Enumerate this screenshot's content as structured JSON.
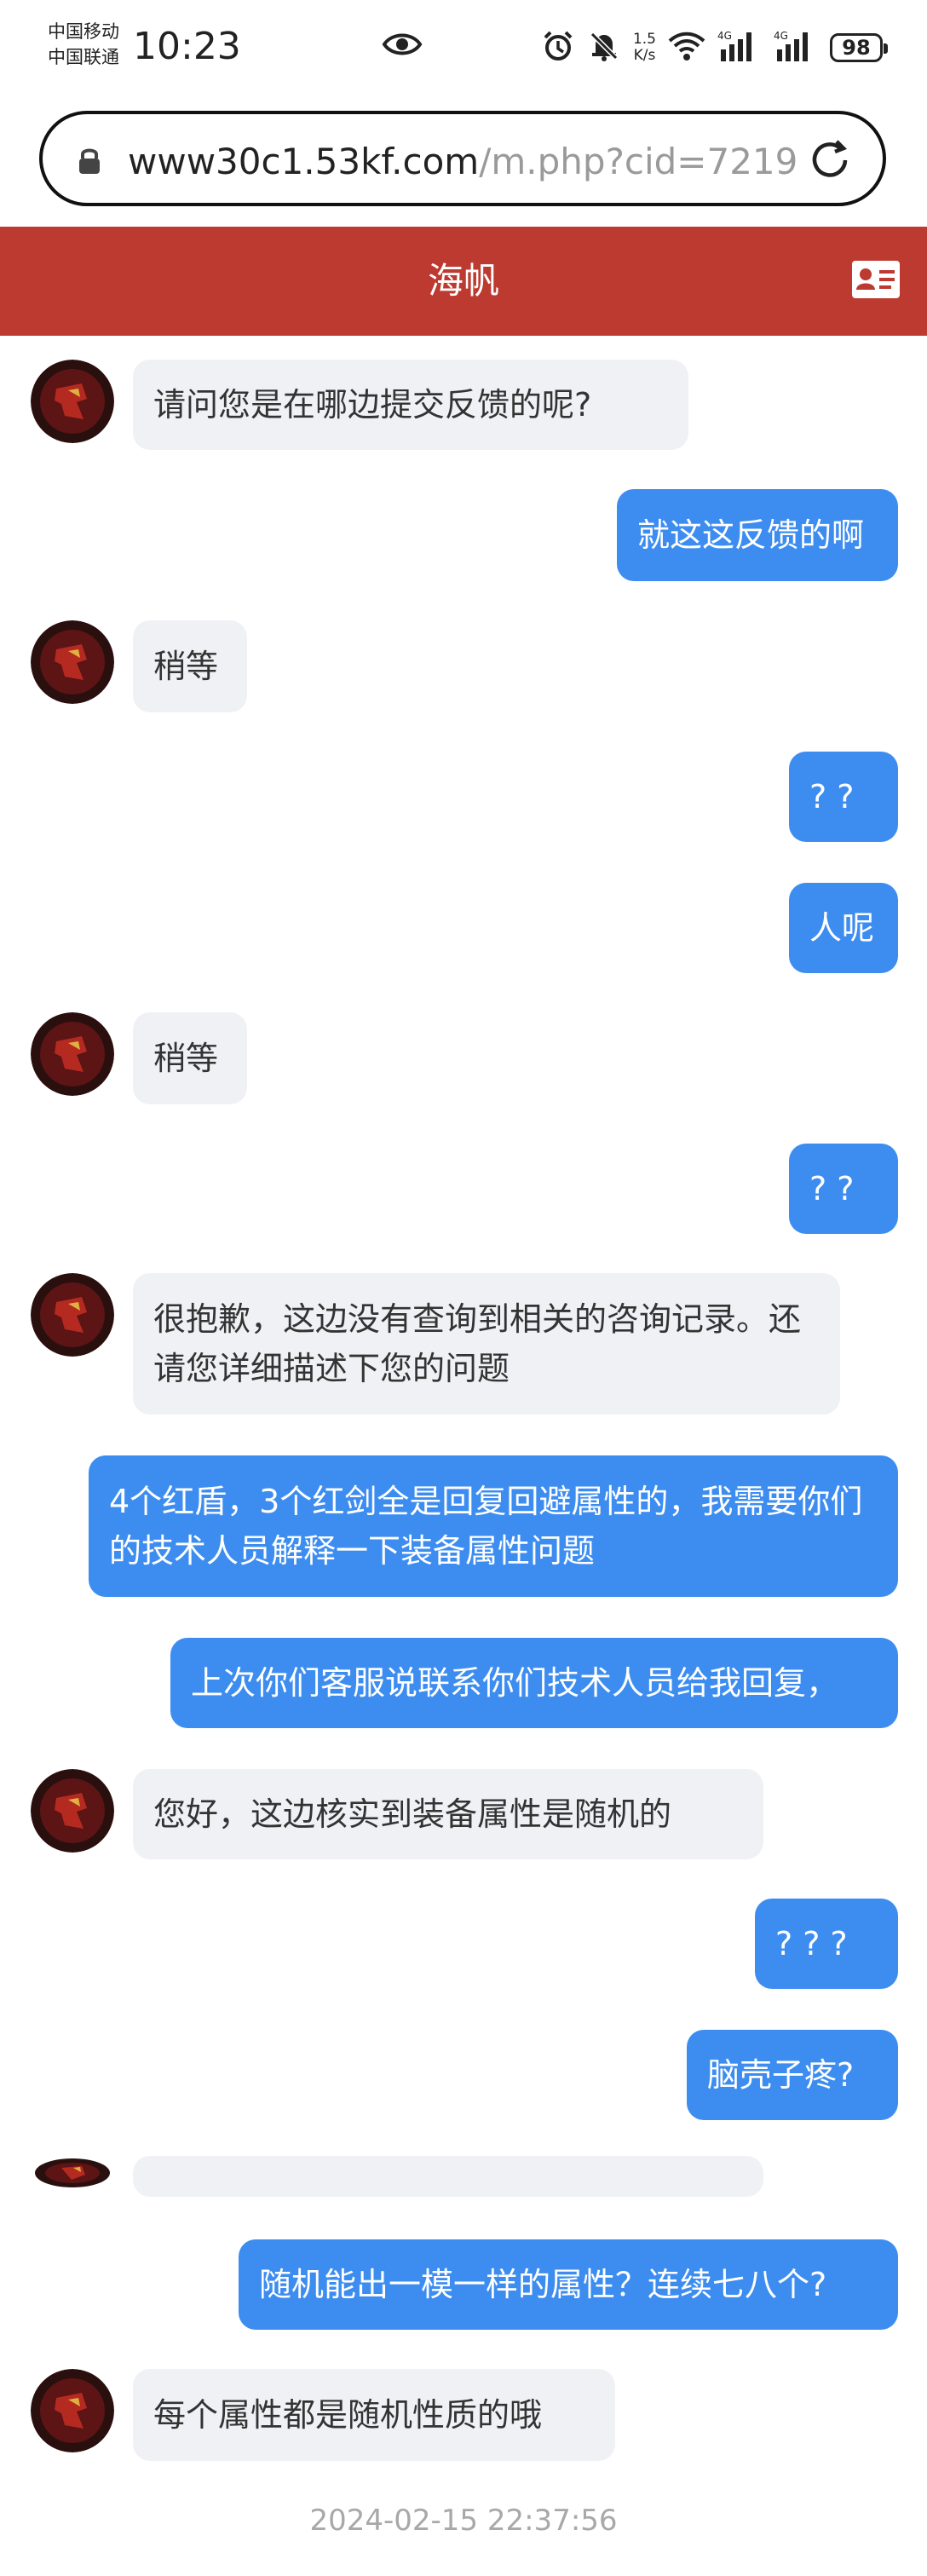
{
  "status_bar": {
    "carrier_1": "中国移动",
    "carrier_2": "中国联通",
    "time": "10:23",
    "speed_value": "1.5",
    "speed_unit": "K/s",
    "battery": "98",
    "net_1": "4G",
    "net_2": "4G"
  },
  "browser": {
    "url_domain": "www30c1.53kf.com",
    "url_path": "/m.php?cid=7219"
  },
  "header": {
    "title": "海帆"
  },
  "messages": [
    {
      "from": "agent",
      "text": "请问您是在哪边提交反馈的呢?"
    },
    {
      "from": "user",
      "text": "就这这反馈的啊"
    },
    {
      "from": "agent",
      "text": "稍等"
    },
    {
      "from": "user",
      "text": "? ?"
    },
    {
      "from": "user",
      "text": "人呢"
    },
    {
      "from": "agent",
      "text": "稍等"
    },
    {
      "from": "user",
      "text": "? ?"
    },
    {
      "from": "agent",
      "text": "很抱歉，这边没有查询到相关的咨询记录。还请您详细描述下您的问题"
    },
    {
      "from": "user",
      "text": "4个红盾，3个红剑全是回复回避属性的，我需要你们的技术人员解释一下装备属性问题"
    },
    {
      "from": "user",
      "text": "上次你们客服说联系你们技术人员给我回复，"
    },
    {
      "from": "agent",
      "text": "您好，这边核实到装备属性是随机的"
    },
    {
      "from": "user",
      "text": "? ? ?"
    },
    {
      "from": "user",
      "text": "脑壳子疼?"
    },
    {
      "from": "agent",
      "text": ""
    },
    {
      "from": "user",
      "text": "随机能出一模一样的属性？连续七八个?"
    },
    {
      "from": "agent",
      "text": "每个属性都是随机性质的哦"
    }
  ],
  "timestamp": "2024-02-15 22:37:56",
  "colors": {
    "header": "#bd3a30",
    "user_bubble": "#3d8df0",
    "agent_bubble": "#eff1f4"
  }
}
